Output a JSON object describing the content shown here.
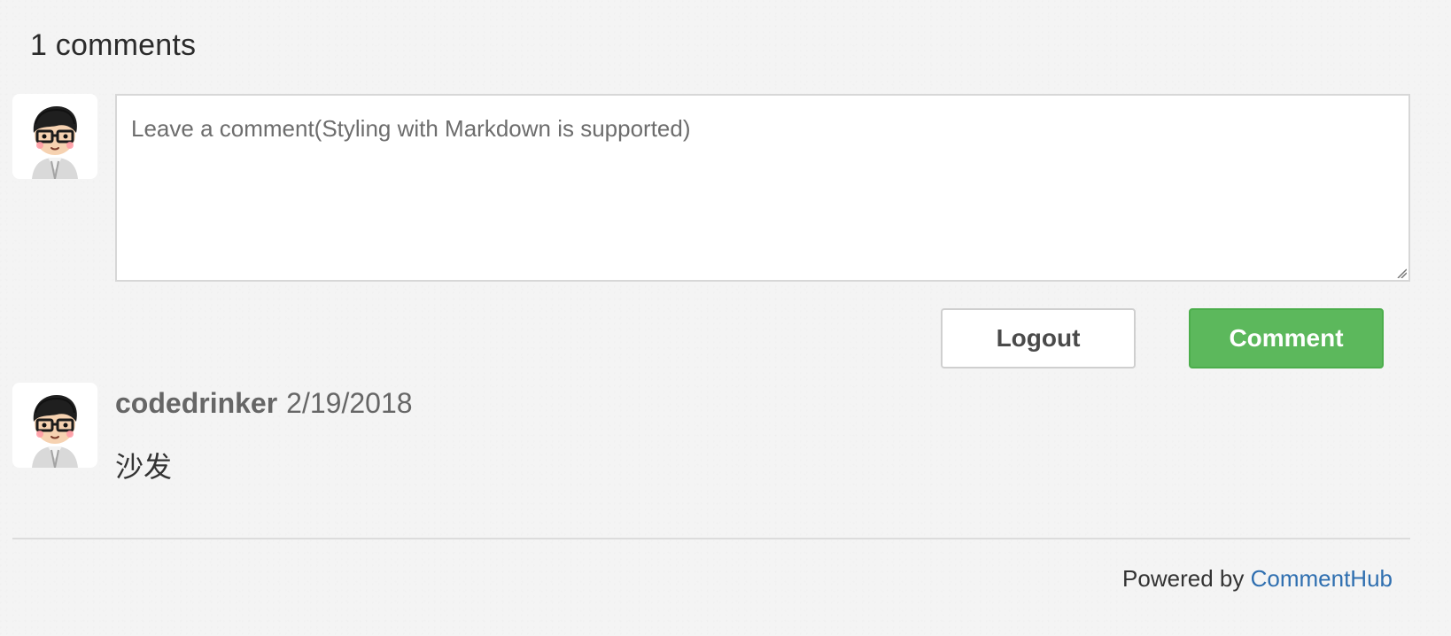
{
  "header": {
    "title": "1 comments"
  },
  "composer": {
    "placeholder": "Leave a comment(Styling with Markdown is supported)",
    "avatar_icon": "user-avatar-icon"
  },
  "actions": {
    "logout_label": "Logout",
    "comment_label": "Comment"
  },
  "comments": [
    {
      "author": "codedrinker",
      "date": "2/19/2018",
      "body": "沙发",
      "avatar_icon": "user-avatar-icon"
    }
  ],
  "footer": {
    "prefix": "Powered by",
    "brand_link": "CommentHub"
  },
  "colors": {
    "background": "#f4f4f4",
    "primary_button": "#5cb85c",
    "link": "#2f6fb0",
    "divider": "#dcdcdc"
  }
}
